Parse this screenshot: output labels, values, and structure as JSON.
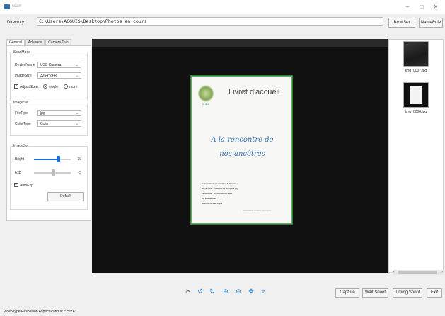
{
  "window": {
    "title": "scan",
    "minimize": "–",
    "maximize": "□",
    "close": "✕"
  },
  "directory": {
    "label": "Directory",
    "value": "C:\\Users\\ACGUIS\\Desktop\\Photos en cours",
    "browse_label": "BrowSer",
    "name_rule_label": "NameRule"
  },
  "tabs": [
    "General",
    "Advance",
    "Camera Two"
  ],
  "scan_mode": {
    "title": "ScanMode",
    "device_label": "DeviceName",
    "device_value": "USB Camera",
    "image_size_label": "ImageSize",
    "image_size_value": "3264*2448",
    "adjust_skew_label": "AdjustSkew:",
    "adjust_skew_checked": "✓",
    "single_label": "single",
    "more_label": "more"
  },
  "image_set_1": {
    "title": "ImageSet",
    "file_type_label": "FileType",
    "file_type_value": "jpg",
    "color_type_label": "ColorType",
    "color_type_value": "Color"
  },
  "image_set_2": {
    "title": "ImageSet",
    "bright_label": "Bright",
    "bright_value": "29",
    "exp_label": "Exp",
    "exp_value": "-5",
    "auto_exp_label": "AutoExp",
    "auto_exp_checked": "✓",
    "default_label": "Default"
  },
  "document": {
    "logo_text": "Le lacet",
    "title": "Livret d'accueil",
    "headline_1": "A la rencontre de",
    "headline_2": "nos ancêtres",
    "lines": [
      "Sept. aide de recherche: 1 Janvier",
      "Ouverture :  Éditions de la Cigale (a)",
      "Fermeture :  15 novembre 2024",
      "Au lieu de filés",
      "Recherches en ligne"
    ],
    "faint_line": "Association le lacet - ACGUIS"
  },
  "thumbnails": [
    {
      "label": "Img_0007.jpg"
    },
    {
      "label": "Img_0008.jpg"
    }
  ],
  "toolbar_icons": [
    "crop-icon",
    "rotate-left-icon",
    "rotate-right-icon",
    "zoom-in-icon",
    "zoom-out-icon",
    "move-icon",
    "fit-icon"
  ],
  "actions": {
    "capture": "Capture",
    "wait_shoot": "Wait Shoot",
    "timing_shoot": "Timing Shoot",
    "exit": "Exit"
  },
  "status": {
    "text": "VideoType  Resolution  Aspect Ratio  X:Y:  SIZE:"
  },
  "colors": {
    "accent": "#1e6fd9",
    "icon": "#2b8fe3",
    "page_border": "#5ab85a",
    "headline": "#3a76b7"
  }
}
